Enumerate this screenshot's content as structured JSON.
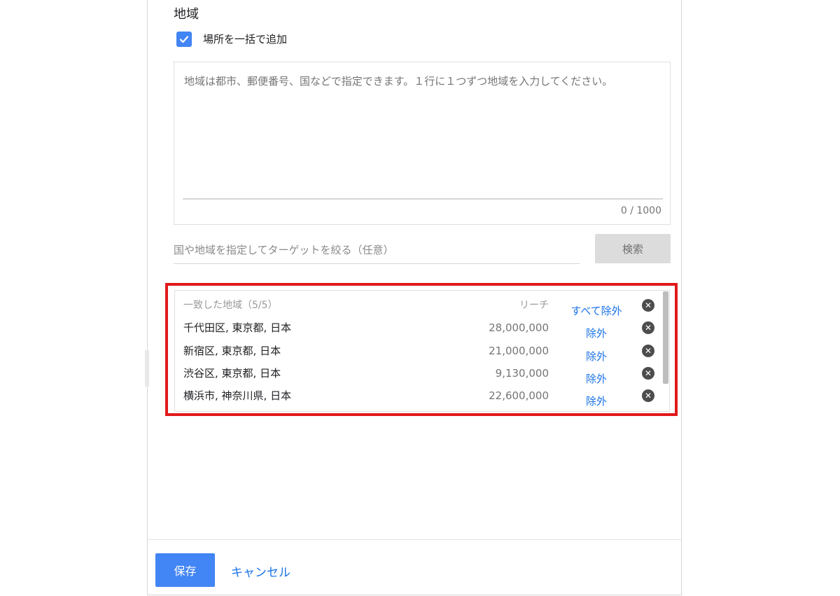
{
  "section": {
    "title": "地域",
    "bulk_add_label": "場所を一括で追加",
    "bulk_add_checked": true
  },
  "textarea": {
    "placeholder": "地域は都市、郵便番号、国などで指定できます。１行に１つずつ地域を入力してください。",
    "char_count": "0 / 1000"
  },
  "filter": {
    "placeholder": "国や地域を指定してターゲットを絞る（任意）",
    "search_label": "検索"
  },
  "results": {
    "header_matched": "一致した地域（5/5）",
    "header_reach": "リーチ",
    "exclude_all_label": "すべて除外",
    "rows": [
      {
        "name": "千代田区, 東京都, 日本",
        "reach": "28,000,000",
        "action": "除外"
      },
      {
        "name": "新宿区, 東京都, 日本",
        "reach": "21,000,000",
        "action": "除外"
      },
      {
        "name": "渋谷区, 東京都, 日本",
        "reach": "9,130,000",
        "action": "除外"
      },
      {
        "name": "横浜市, 神奈川県, 日本",
        "reach": "22,600,000",
        "action": "除外"
      }
    ]
  },
  "footer": {
    "save_label": "保存",
    "cancel_label": "キャンセル"
  },
  "colors": {
    "accent": "#4285f4",
    "link": "#1a73e8",
    "highlight_border": "#e0191a"
  }
}
